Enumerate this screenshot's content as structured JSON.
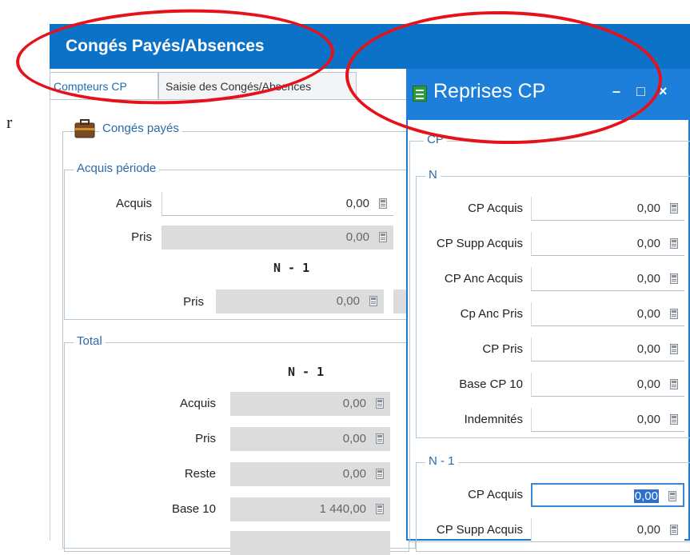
{
  "window": {
    "title": "Congés Payés/Absences"
  },
  "tabs": [
    {
      "label": "Compteurs CP",
      "active": true
    },
    {
      "label": "Saisie des Congés/Absences",
      "active": false
    }
  ],
  "conges": {
    "title": "Congés payés",
    "acquis_periode": {
      "legend": "Acquis période",
      "rows": [
        {
          "label": "Acquis",
          "value": "0,00"
        },
        {
          "label": "Pris",
          "value": "0,00"
        }
      ],
      "n1_header": "N - 1",
      "n1_pris": {
        "label": "Pris",
        "value": "0,00"
      }
    },
    "total": {
      "legend": "Total",
      "header": "N - 1",
      "rows": [
        {
          "label": "Acquis",
          "value": "0,00"
        },
        {
          "label": "Pris",
          "value": "0,00"
        },
        {
          "label": "Reste",
          "value": "0,00"
        },
        {
          "label": "Base 10",
          "value": "1 440,00"
        }
      ]
    }
  },
  "reprises": {
    "title": "Reprises CP",
    "section": "CP",
    "n": {
      "legend": "N",
      "rows": [
        {
          "label": "CP Acquis",
          "value": "0,00"
        },
        {
          "label": "CP Supp Acquis",
          "value": "0,00"
        },
        {
          "label": "CP Anc Acquis",
          "value": "0,00"
        },
        {
          "label": "Cp Anc Pris",
          "value": "0,00"
        },
        {
          "label": "CP Pris",
          "value": "0,00"
        },
        {
          "label": "Base CP 10",
          "value": "0,00"
        },
        {
          "label": "Indemnités",
          "value": "0,00"
        }
      ]
    },
    "n1": {
      "legend": "N - 1",
      "rows": [
        {
          "label": "CP Acquis",
          "value": "0,00",
          "focused": true
        },
        {
          "label": "CP Supp Acquis",
          "value": "0,00"
        }
      ]
    },
    "buttons": {
      "minimize": "–",
      "maximize": "□",
      "close": "×"
    }
  },
  "colors": {
    "title_bar": "#0c72c8",
    "reprises_title_bar": "#1d7fd9",
    "annotation": "#e5121b"
  },
  "stray_char": "r"
}
